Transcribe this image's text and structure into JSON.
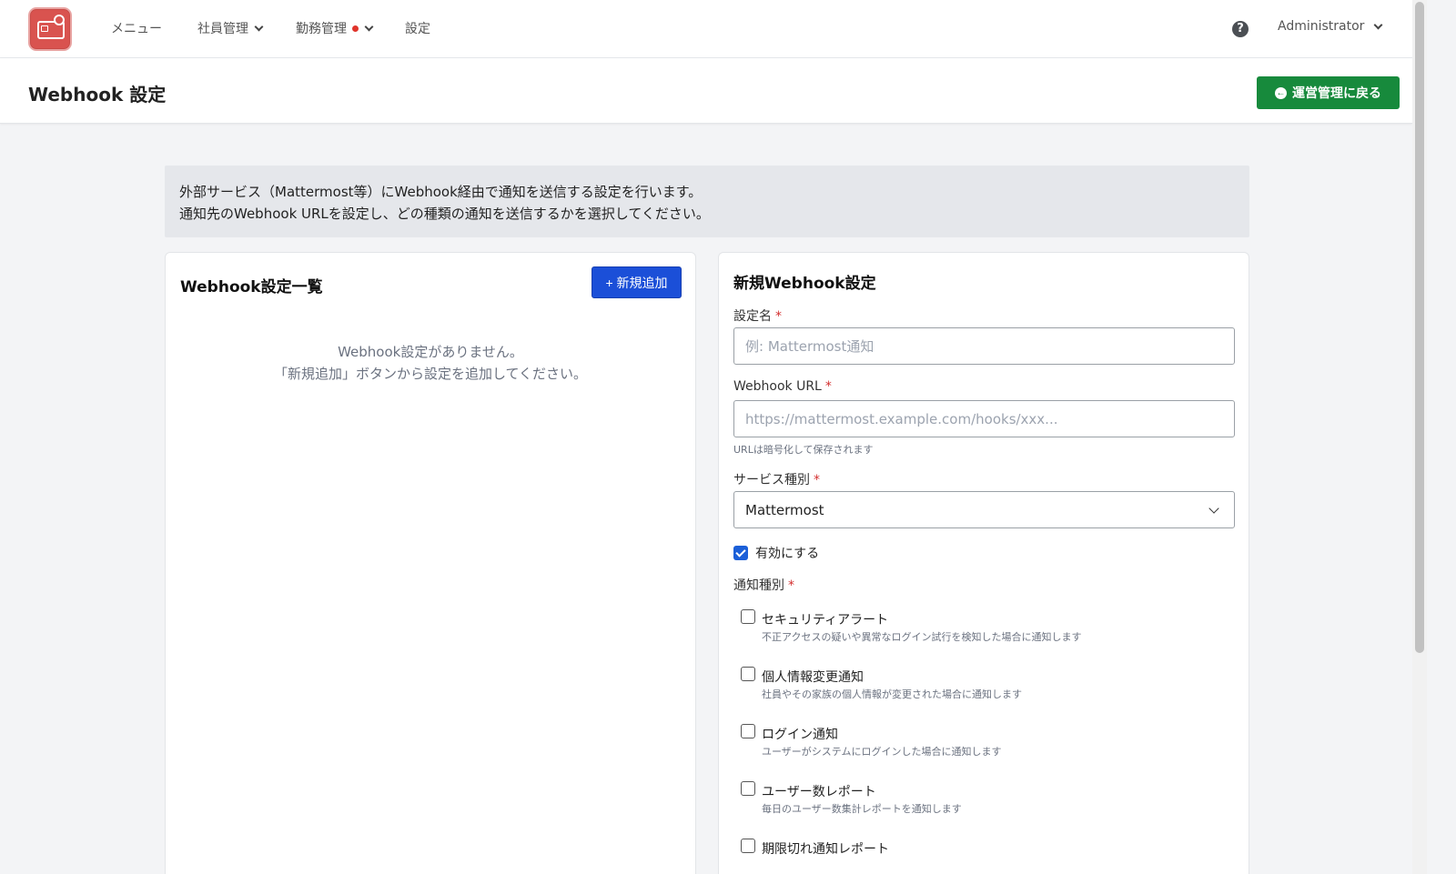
{
  "nav": {
    "items": [
      {
        "label": "メニュー"
      },
      {
        "label": "社員管理"
      },
      {
        "label": "勤務管理"
      },
      {
        "label": "設定"
      }
    ],
    "user": "Administrator",
    "help_icon": "question-circle-icon",
    "logo_icon": "card-lock-icon"
  },
  "header": {
    "title": "Webhook 設定",
    "back_button": "運営管理に戻る"
  },
  "info": {
    "line1": "外部サービス（Mattermost等）にWebhook経由で通知を送信する設定を行います。",
    "line2": "通知先のWebhook URLを設定し、どの種類の通知を送信するかを選択してください。"
  },
  "list_panel": {
    "title": "Webhook設定一覧",
    "add_button": "+ 新規追加",
    "empty_line1": "Webhook設定がありません。",
    "empty_line2": "「新規追加」ボタンから設定を追加してください。"
  },
  "form": {
    "title": "新規Webhook設定",
    "name_label": "設定名",
    "name_placeholder": "例: Mattermost通知",
    "url_label": "Webhook URL",
    "url_placeholder": "https://mattermost.example.com/hooks/xxx...",
    "url_hint": "URLは暗号化して保存されます",
    "service_label": "サービス種別",
    "service_value": "Mattermost",
    "enabled_label": "有効にする",
    "enabled": true,
    "required_mark": "*",
    "notify_label": "通知種別",
    "notify_options": [
      {
        "title": "セキュリティアラート",
        "desc": "不正アクセスの疑いや異常なログイン試行を検知した場合に通知します",
        "checked": false
      },
      {
        "title": "個人情報変更通知",
        "desc": "社員やその家族の個人情報が変更された場合に通知します",
        "checked": false
      },
      {
        "title": "ログイン通知",
        "desc": "ユーザーがシステムにログインした場合に通知します",
        "checked": false
      },
      {
        "title": "ユーザー数レポート",
        "desc": "毎日のユーザー数集計レポートを通知します",
        "checked": false
      },
      {
        "title": "期限切れ通知レポート",
        "desc": "",
        "checked": false
      }
    ]
  },
  "colors": {
    "primary_button": "#1b4fd8",
    "back_button": "#178a3c",
    "notification_dot": "#e0342b",
    "logo": "#d9534f"
  }
}
